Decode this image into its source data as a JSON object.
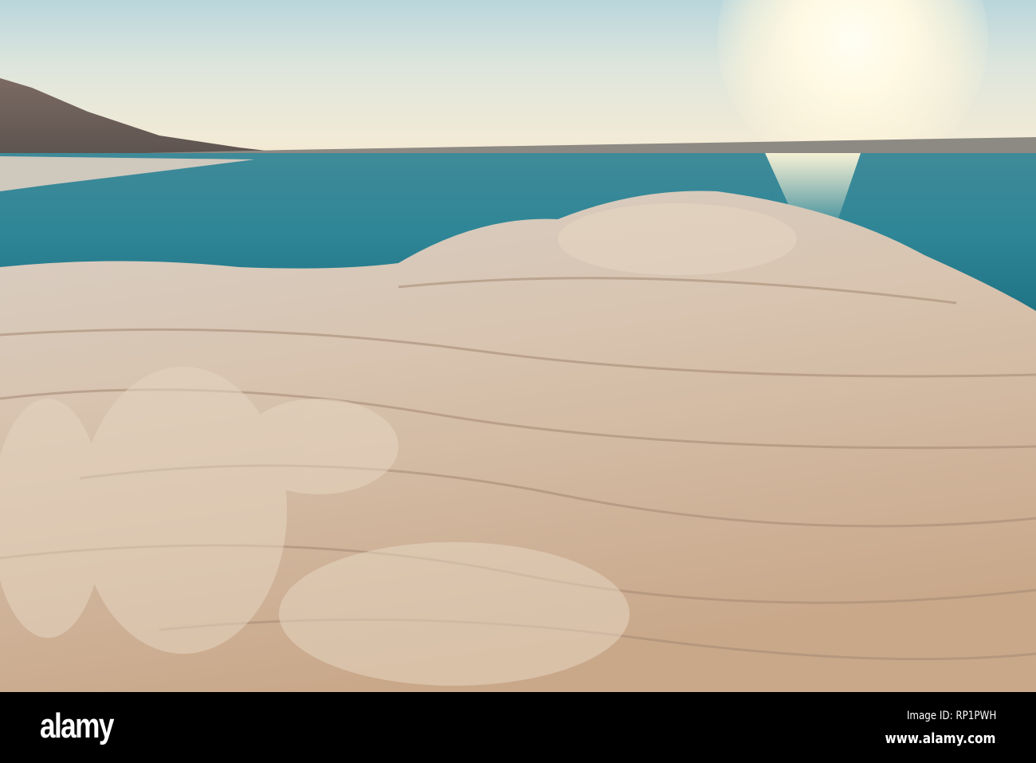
{
  "watermark": {
    "logo": "alamy",
    "image_id": "Image ID: RP1PWH",
    "url": "www.alamy.com"
  }
}
